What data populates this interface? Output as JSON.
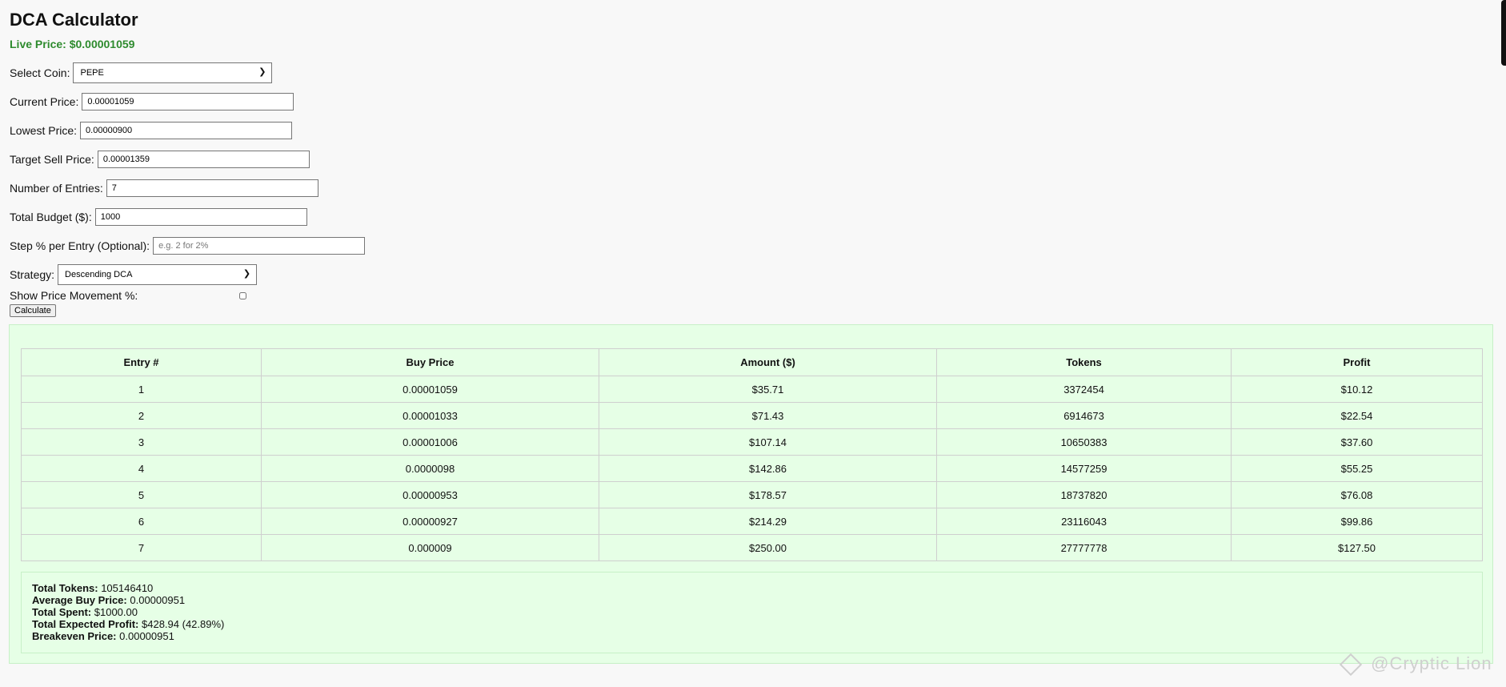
{
  "app": {
    "title": "DCA Calculator",
    "live_price_label": "Live Price: $0.00001059"
  },
  "form": {
    "coin_label": "Select Coin:",
    "coin_value": "PEPE",
    "current_price_label": "Current Price:",
    "current_price_value": "0.00001059",
    "lowest_price_label": "Lowest Price:",
    "lowest_price_value": "0.00000900",
    "target_sell_label": "Target Sell Price:",
    "target_sell_value": "0.00001359",
    "entries_label": "Number of Entries:",
    "entries_value": "7",
    "budget_label": "Total Budget ($):",
    "budget_value": "1000",
    "step_label": "Step % per Entry (Optional):",
    "step_placeholder": "e.g. 2 for 2%",
    "strategy_label": "Strategy:",
    "strategy_value": "Descending DCA",
    "movement_label": "Show Price Movement %:",
    "calculate_label": "Calculate"
  },
  "table": {
    "headers": [
      "Entry #",
      "Buy Price",
      "Amount ($)",
      "Tokens",
      "Profit"
    ],
    "rows": [
      [
        "1",
        "0.00001059",
        "$35.71",
        "3372454",
        "$10.12"
      ],
      [
        "2",
        "0.00001033",
        "$71.43",
        "6914673",
        "$22.54"
      ],
      [
        "3",
        "0.00001006",
        "$107.14",
        "10650383",
        "$37.60"
      ],
      [
        "4",
        "0.0000098",
        "$142.86",
        "14577259",
        "$55.25"
      ],
      [
        "5",
        "0.00000953",
        "$178.57",
        "18737820",
        "$76.08"
      ],
      [
        "6",
        "0.00000927",
        "$214.29",
        "23116043",
        "$99.86"
      ],
      [
        "7",
        "0.000009",
        "$250.00",
        "27777778",
        "$127.50"
      ]
    ]
  },
  "summary": {
    "total_tokens_label": "Total Tokens:",
    "total_tokens_value": "105146410",
    "avg_price_label": "Average Buy Price:",
    "avg_price_value": "0.00000951",
    "total_spent_label": "Total Spent:",
    "total_spent_value": "$1000.00",
    "expected_profit_label": "Total Expected Profit:",
    "expected_profit_value": "$428.94 (42.89%)",
    "breakeven_label": "Breakeven Price:",
    "breakeven_value": "0.00000951"
  },
  "watermark": "@Cryptic Lion",
  "colors": {
    "live_price": "#2e8b2e",
    "results_bg": "#e6ffe6",
    "page_bg": "#f8f8f8"
  }
}
